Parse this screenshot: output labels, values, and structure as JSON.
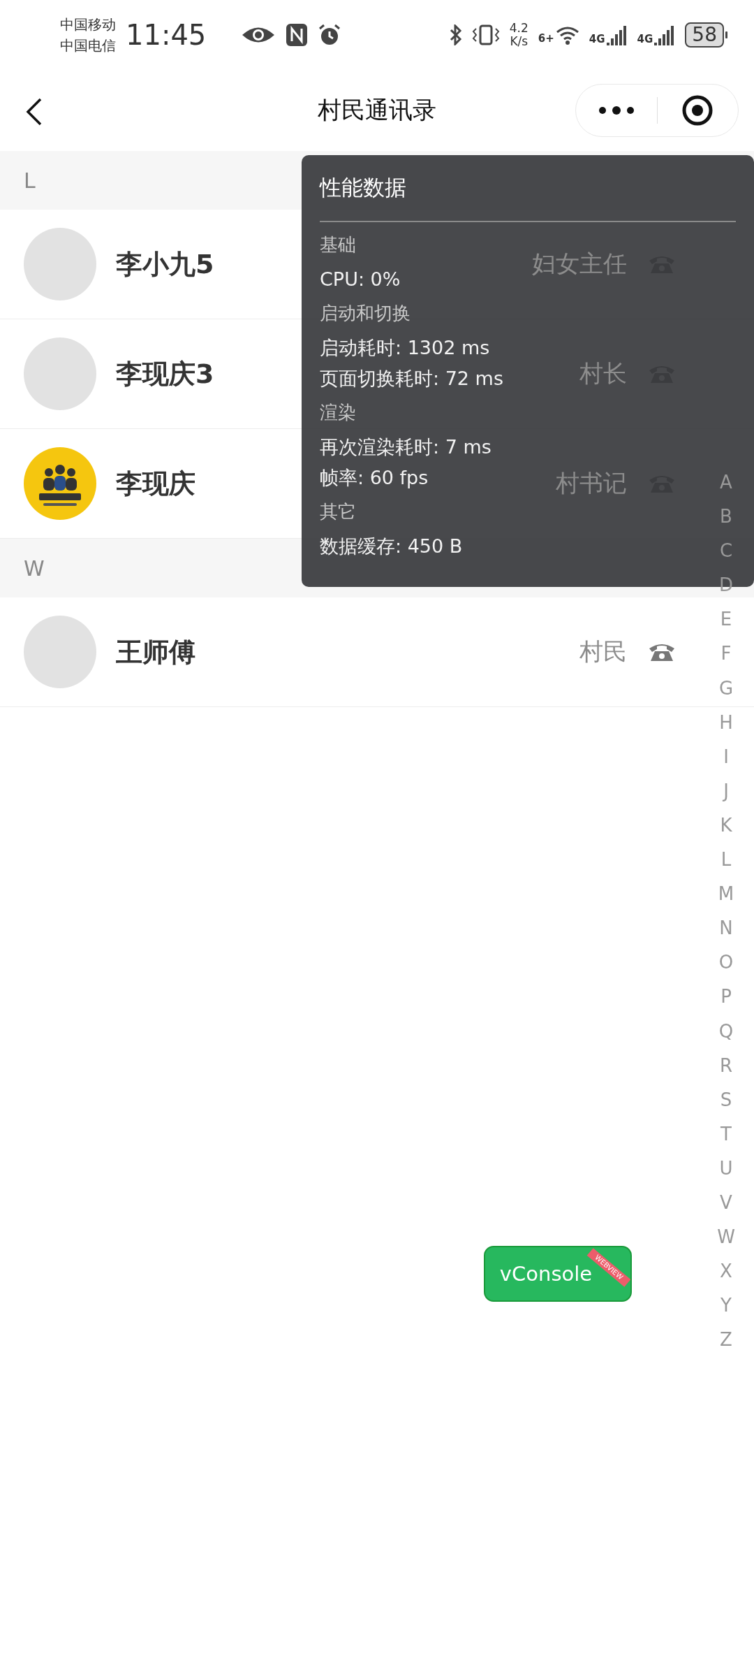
{
  "status_bar": {
    "carriers": [
      "中国移动",
      "中国电信"
    ],
    "time": "11:45",
    "net_speed": [
      "4.2",
      "K/s"
    ],
    "wifi_label": "6+",
    "signal_labels": [
      "4G",
      "4G"
    ],
    "battery": "58"
  },
  "nav_bar": {
    "title": "村民通讯录"
  },
  "sections": [
    {
      "letter": "L",
      "contacts": [
        {
          "name": "李小九5",
          "role": "妇女主任",
          "kind": "placeholder"
        },
        {
          "name": "李现庆3",
          "role": "村长",
          "kind": "placeholder"
        },
        {
          "name": "李现庆",
          "role": "村书记",
          "kind": "picture"
        }
      ]
    },
    {
      "letter": "W",
      "contacts": [
        {
          "name": "王师傅",
          "role": "村民",
          "kind": "placeholder"
        }
      ]
    }
  ],
  "index_letters": [
    "A",
    "B",
    "C",
    "D",
    "E",
    "F",
    "G",
    "H",
    "I",
    "J",
    "K",
    "L",
    "M",
    "N",
    "O",
    "P",
    "Q",
    "R",
    "S",
    "T",
    "U",
    "V",
    "W",
    "X",
    "Y",
    "Z"
  ],
  "performance_panel": {
    "title": "性能数据",
    "groups": [
      {
        "heading": "基础",
        "lines": [
          "CPU: 0%"
        ]
      },
      {
        "heading": "启动和切换",
        "lines": [
          "启动耗时: 1302 ms",
          "页面切换耗时: 72 ms"
        ]
      },
      {
        "heading": "渲染",
        "lines": [
          "再次渲染耗时: 7 ms",
          "帧率: 60 fps"
        ]
      },
      {
        "heading": "其它",
        "lines": [
          "数据缓存: 450 B"
        ]
      }
    ]
  },
  "vconsole_button": {
    "label": "vConsole",
    "ribbon": "WEBVIEW"
  }
}
